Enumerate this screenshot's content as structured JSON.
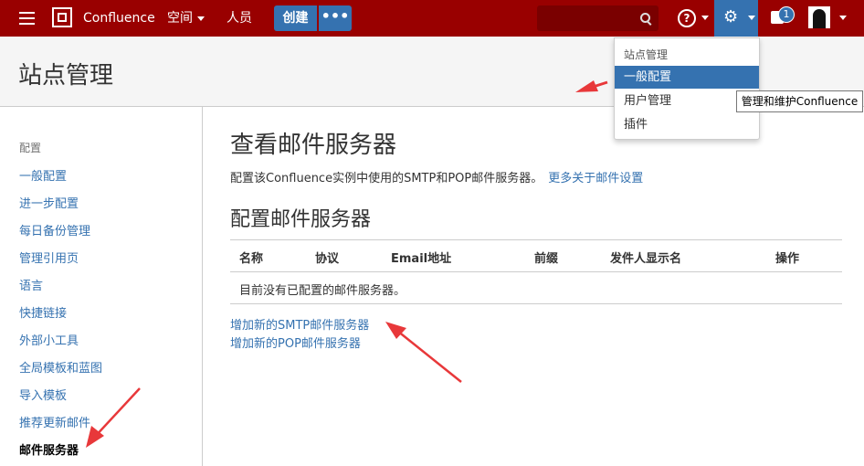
{
  "topbar": {
    "brand": "Confluence",
    "spaces_label": "空间",
    "people_label": "人员",
    "create_label": "创建",
    "more_label": "•••",
    "help_label": "?",
    "notification_count": "1"
  },
  "header": {
    "title": "站点管理"
  },
  "sidebar": {
    "heading": "配置",
    "items": [
      "一般配置",
      "进一步配置",
      "每日备份管理",
      "管理引用页",
      "语言",
      "快捷链接",
      "外部小工具",
      "全局模板和蓝图",
      "导入模板",
      "推荐更新邮件",
      "邮件服务器"
    ]
  },
  "main": {
    "title": "查看邮件服务器",
    "description": "配置该Confluence实例中使用的SMTP和POP邮件服务器。",
    "more_link": "更多关于邮件设置",
    "subtitle": "配置邮件服务器",
    "table": {
      "headers": [
        "名称",
        "协议",
        "Email地址",
        "前缀",
        "发件人显示名",
        "操作"
      ],
      "empty_message": "目前没有已配置的邮件服务器。"
    },
    "add_smtp": "增加新的SMTP邮件服务器",
    "add_pop": "增加新的POP邮件服务器"
  },
  "dropdown": {
    "heading": "站点管理",
    "items": [
      "一般配置",
      "用户管理",
      "插件"
    ]
  },
  "tooltip": "管理和维护Confluence",
  "colors": {
    "topbar": "#990000",
    "accent": "#3572b0",
    "annotation": "#e8383a"
  }
}
